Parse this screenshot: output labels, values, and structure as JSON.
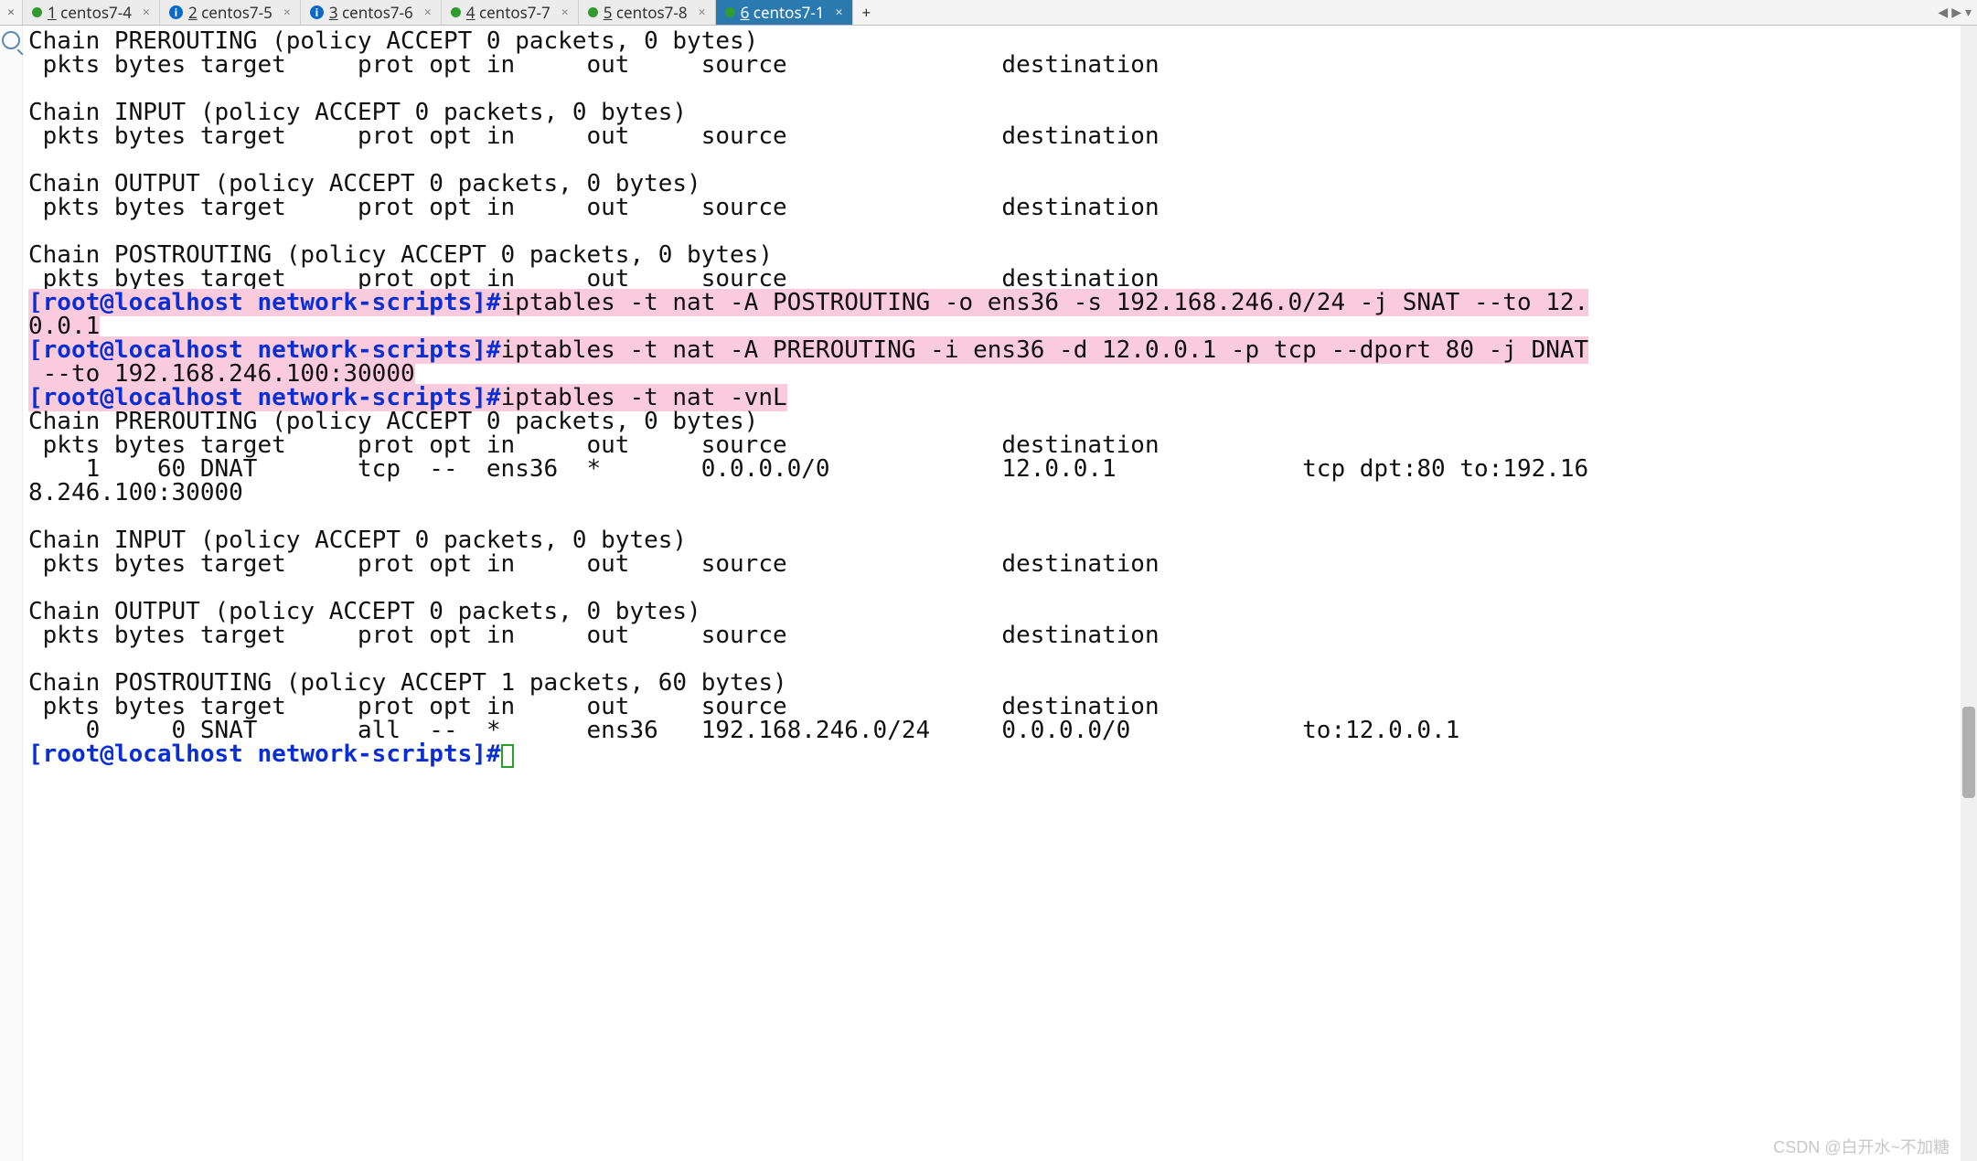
{
  "tabs": [
    {
      "icon": "green-dot",
      "num": "1",
      "label": "centos7-4",
      "active": false
    },
    {
      "icon": "info",
      "num": "2",
      "label": "centos7-5",
      "active": false
    },
    {
      "icon": "info",
      "num": "3",
      "label": "centos7-6",
      "active": false
    },
    {
      "icon": "green-dot",
      "num": "4",
      "label": "centos7-7",
      "active": false
    },
    {
      "icon": "green-dot",
      "num": "5",
      "label": "centos7-8",
      "active": false
    },
    {
      "icon": "green-dot",
      "num": "6",
      "label": "centos7-1",
      "active": true
    }
  ],
  "closeall": "×",
  "addtab": "+",
  "nav": {
    "left": "◀",
    "right": "▶",
    "down": "▾"
  },
  "prompt_prefix": "[root@localhost network-scripts]#",
  "cmd1": "iptables -t nat -A POSTROUTING -o ens36 -s 192.168.246.0/24 -j SNAT --to 12.",
  "cmd1_wrap": "0.0.1",
  "cmd2": "iptables -t nat -A PREROUTING -i ens36 -d 12.0.0.1 -p tcp --dport 80 -j DNAT",
  "cmd2_wrap": " --to 192.168.246.100:30000",
  "cmd3": "iptables -t nat -vnL",
  "out_a": {
    "l1": "Chain PREROUTING (policy ACCEPT 0 packets, 0 bytes)",
    "l2": " pkts bytes target     prot opt in     out     source               destination",
    "l3": "",
    "l4": "Chain INPUT (policy ACCEPT 0 packets, 0 bytes)",
    "l5": " pkts bytes target     prot opt in     out     source               destination",
    "l6": "",
    "l7": "Chain OUTPUT (policy ACCEPT 0 packets, 0 bytes)",
    "l8": " pkts bytes target     prot opt in     out     source               destination",
    "l9": "",
    "l10": "Chain POSTROUTING (policy ACCEPT 0 packets, 0 bytes)",
    "l11": " pkts bytes target     prot opt in     out     source               destination"
  },
  "out_b": {
    "l1": "Chain PREROUTING (policy ACCEPT 0 packets, 0 bytes)",
    "l2": " pkts bytes target     prot opt in     out     source               destination",
    "l3": "    1    60 DNAT       tcp  --  ens36  *       0.0.0.0/0            12.0.0.1             tcp dpt:80 to:192.16",
    "l3b": "8.246.100:30000",
    "l4": "",
    "l5": "Chain INPUT (policy ACCEPT 0 packets, 0 bytes)",
    "l6": " pkts bytes target     prot opt in     out     source               destination",
    "l7": "",
    "l8": "Chain OUTPUT (policy ACCEPT 0 packets, 0 bytes)",
    "l9": " pkts bytes target     prot opt in     out     source               destination",
    "l10": "",
    "l11": "Chain POSTROUTING (policy ACCEPT 1 packets, 60 bytes)",
    "l12": " pkts bytes target     prot opt in     out     source               destination",
    "l13": "    0     0 SNAT       all  --  *      ens36   192.168.246.0/24     0.0.0.0/0            to:12.0.0.1"
  },
  "watermark": "CSDN @白开水~不加糖"
}
